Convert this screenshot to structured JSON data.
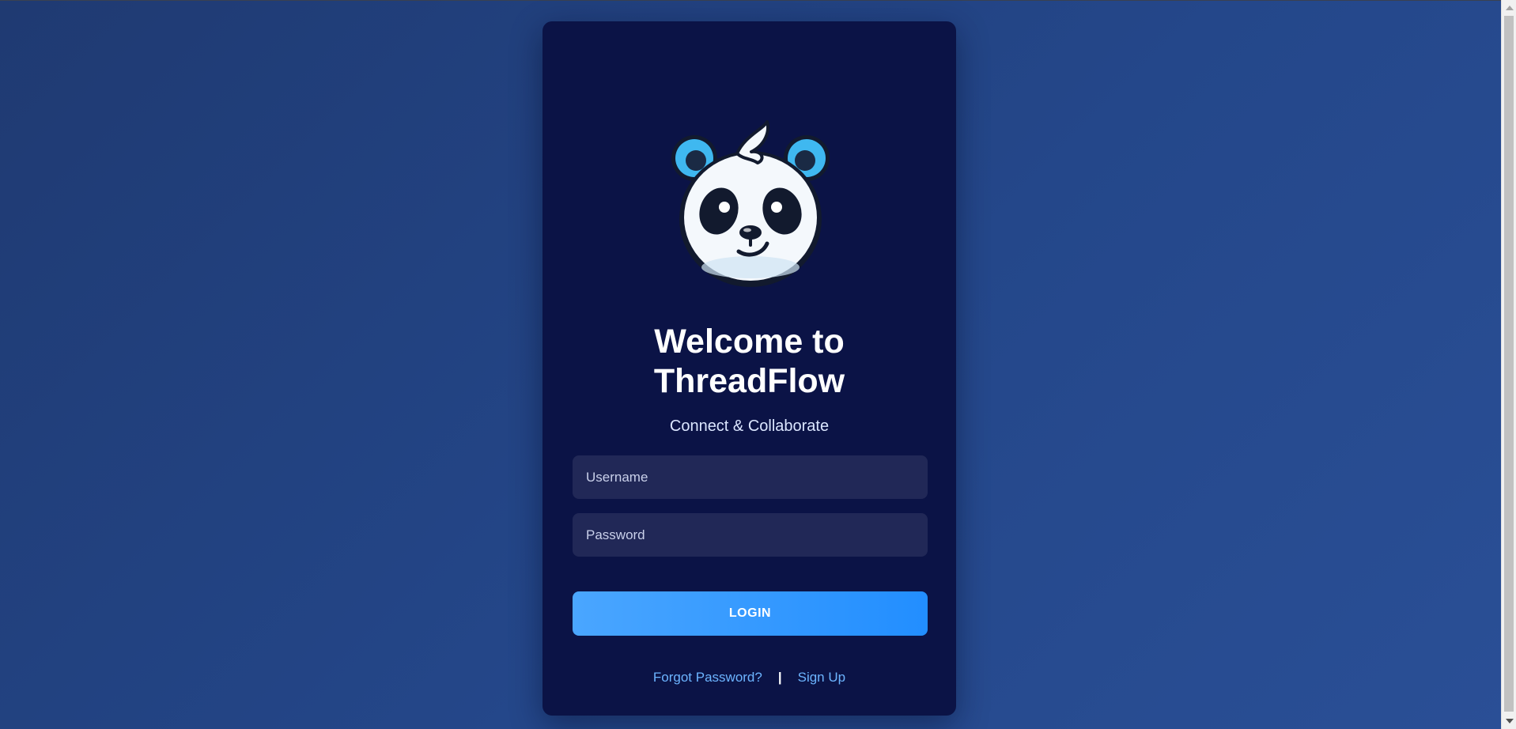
{
  "app": {
    "title": "Welcome to ThreadFlow",
    "title_line1": "Welcome to",
    "title_line2": "ThreadFlow",
    "subtitle": "Connect & Collaborate"
  },
  "form": {
    "username_placeholder": "Username",
    "username_value": "",
    "password_placeholder": "Password",
    "password_value": "",
    "login_label": "LOGIN"
  },
  "links": {
    "forgot_password": "Forgot Password?",
    "separator": "|",
    "sign_up": "Sign Up"
  },
  "icons": {
    "logo": "panda-logo-icon"
  },
  "colors": {
    "page_background": "#24478a",
    "card_background": "#0b1346",
    "input_background": "#212857",
    "button_gradient_start": "#4aa6ff",
    "button_gradient_end": "#228eff",
    "link": "#6cb4ff",
    "panda_ears": "#3fb8f0"
  }
}
